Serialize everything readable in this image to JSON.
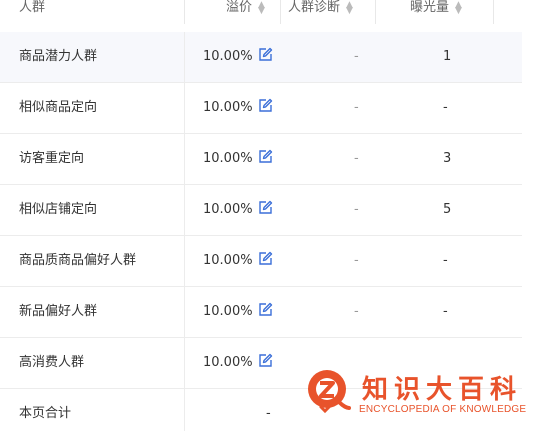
{
  "table": {
    "headers": {
      "name": "人群",
      "premium": "溢价",
      "diagnosis": "人群诊断",
      "exposure": "曝光量",
      "sort_up": "▲",
      "sort_down": "▼"
    },
    "rows": [
      {
        "name": "商品潜力人群",
        "premium": "10.00%",
        "diagnosis": "-",
        "exposure": "1"
      },
      {
        "name": "相似商品定向",
        "premium": "10.00%",
        "diagnosis": "-",
        "exposure": "-"
      },
      {
        "name": "访客重定向",
        "premium": "10.00%",
        "diagnosis": "-",
        "exposure": "3"
      },
      {
        "name": "相似店铺定向",
        "premium": "10.00%",
        "diagnosis": "-",
        "exposure": "5"
      },
      {
        "name": "商品质商品偏好人群",
        "premium": "10.00%",
        "diagnosis": "-",
        "exposure": "-"
      },
      {
        "name": "新品偏好人群",
        "premium": "10.00%",
        "diagnosis": "-",
        "exposure": "-"
      },
      {
        "name": "高消费人群",
        "premium": "10.00%",
        "diagnosis": "",
        "exposure": ""
      }
    ],
    "footer": {
      "name": "本页合计",
      "premium": "-"
    }
  },
  "watermark": {
    "title": "知识大百科",
    "subtitle": "ENCYCLOPEDIA OF KNOWLEDGE",
    "color": "#e8532b"
  },
  "colors": {
    "highlight_row": "#f7f8fc",
    "edit_icon": "#3b6fd8",
    "border": "#ececec"
  }
}
